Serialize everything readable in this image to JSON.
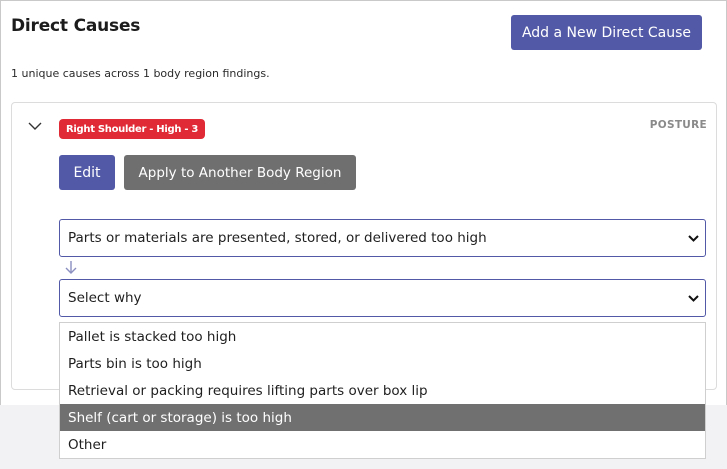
{
  "header": {
    "title": "Direct Causes",
    "add_button_label": "Add a New Direct Cause",
    "summary": "1 unique causes across 1 body region findings."
  },
  "finding": {
    "badge_label": "Right Shoulder - High - 3",
    "badge_color": "#e02b36",
    "category": "POSTURE",
    "edit_label": "Edit",
    "apply_label": "Apply to Another Body Region",
    "cause_select_value": "Parts or materials are presented, stored, or delivered too high",
    "why_select_value": "Select why",
    "why_options": [
      {
        "label": "Pallet is stacked too high",
        "highlighted": false
      },
      {
        "label": "Parts bin is too high",
        "highlighted": false
      },
      {
        "label": "Retrieval or packing requires lifting parts over box lip",
        "highlighted": false
      },
      {
        "label": "Shelf (cart or storage) is too high",
        "highlighted": true
      },
      {
        "label": "Other",
        "highlighted": false
      }
    ]
  },
  "colors": {
    "primary": "#5259a6",
    "secondary_button": "#6f6f6f",
    "highlight_option": "#707070"
  },
  "icons": {
    "collapse": "chevron-down-icon",
    "flow": "arrow-down-icon",
    "select_caret": "caret-down-icon"
  }
}
